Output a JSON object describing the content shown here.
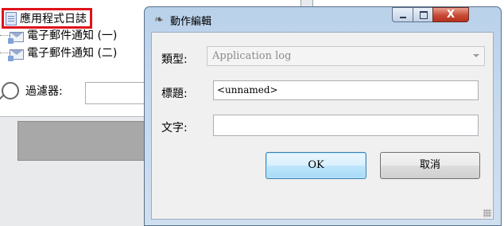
{
  "background": {
    "tree_items": [
      {
        "label": "應用程式日誌",
        "icon": "log-document-icon",
        "highlighted": true
      },
      {
        "label": "電子郵件通知 (一)",
        "icon": "email-icon"
      },
      {
        "label": "電子郵件通知 (二)",
        "icon": "email-icon"
      }
    ],
    "filter": {
      "label": "過濾器:",
      "icon": "search-icon",
      "value": ""
    },
    "highlight_color": "#e0121b"
  },
  "dialog": {
    "title": "動作編輯",
    "title_icon": "edit-icon",
    "window_buttons": {
      "minimize_icon": "minimize-icon",
      "maximize_icon": "maximize-icon",
      "close_label": "X"
    },
    "fields": {
      "type_label": "類型:",
      "type_value": "Application log",
      "title_label": "標題:",
      "title_value": "<unnamed>",
      "text_label": "文字:",
      "text_value": ""
    },
    "buttons": {
      "ok_label": "OK",
      "cancel_label": "取消"
    }
  }
}
